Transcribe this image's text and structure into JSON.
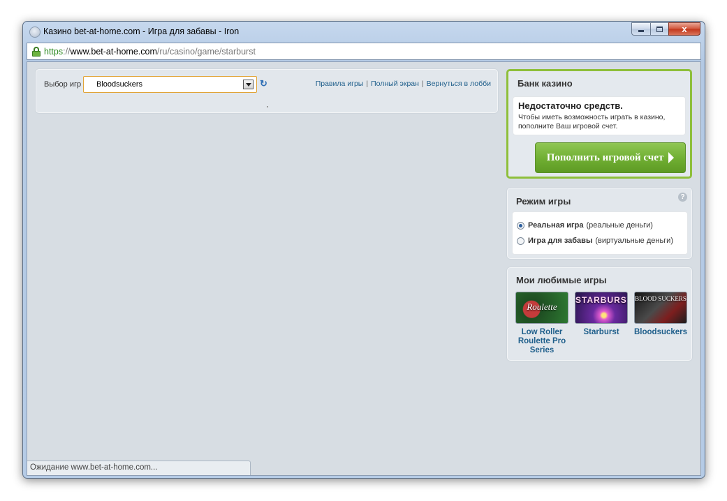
{
  "window": {
    "title": "Казино bet-at-home.com - Игра для забавы - Iron",
    "close_glyph": "x"
  },
  "address": {
    "scheme": "https",
    "separator": "://",
    "host": "www.bet-at-home.com",
    "path": "/ru/casino/game/starburst"
  },
  "game_bar": {
    "label": "Выбор игр",
    "selected_game": "Bloodsuckers",
    "refresh_glyph": "↻",
    "links": [
      "Правила игры",
      "Полный экран",
      "Вернуться в лобби"
    ],
    "link_separator": "|"
  },
  "bank": {
    "title": "Банк казино",
    "message_heading": "Недостаточно средств.",
    "message_body": "Чтобы иметь возможность играть в казино, пополните Ваш игровой счет.",
    "deposit_button": "Пополнить игровой счет"
  },
  "mode": {
    "title": "Режим игры",
    "help_glyph": "?",
    "options": [
      {
        "label": "Реальная игра",
        "hint": "(реальные деньги)",
        "selected": true
      },
      {
        "label": "Игра для забавы",
        "hint": "(виртуальные деньги)",
        "selected": false
      }
    ]
  },
  "favorites": {
    "title": "Мои любимые игры",
    "games": [
      {
        "name": "Low Roller Roulette Pro Series",
        "logo": "Roulette",
        "icon": "roulette-thumbnail"
      },
      {
        "name": "Starburst",
        "logo": "STARBURST",
        "icon": "starburst-thumbnail"
      },
      {
        "name": "Bloodsuckers",
        "logo": "BLOOD SUCKERS",
        "icon": "bloodsuckers-thumbnail"
      }
    ]
  },
  "status": {
    "text": "Ожидание www.bet-at-home.com..."
  },
  "colors": {
    "accent_green": "#8ebf3a",
    "link_blue": "#1f5f8b",
    "select_border": "#e1a437"
  }
}
